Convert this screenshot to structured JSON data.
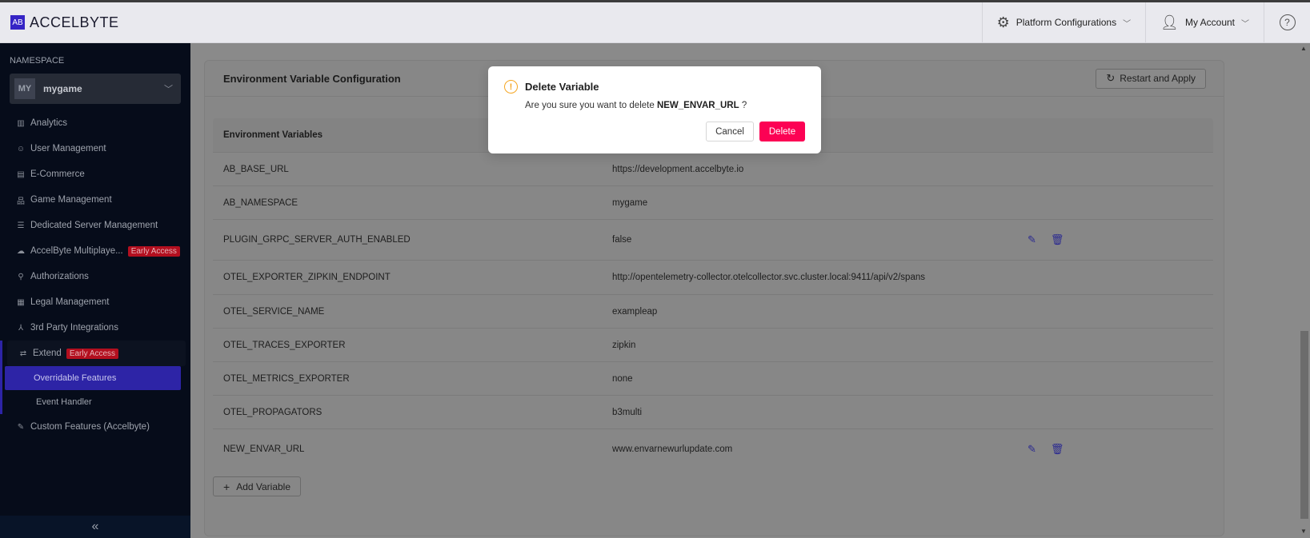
{
  "header": {
    "brand": "ACCELBYTE",
    "brand_mark": "AB",
    "platform_configurations": "Platform Configurations",
    "my_account": "My Account",
    "help_icon": "?"
  },
  "sidebar": {
    "namespace_label": "NAMESPACE",
    "namespace_badge": "MY",
    "namespace_name": "mygame",
    "items": [
      {
        "label": "Analytics",
        "icon": "chart-icon"
      },
      {
        "label": "User Management",
        "icon": "user-icon"
      },
      {
        "label": "E-Commerce",
        "icon": "store-icon"
      },
      {
        "label": "Game Management",
        "icon": "hierarchy-icon"
      },
      {
        "label": "Dedicated Server Management",
        "icon": "server-icon"
      },
      {
        "label": "AccelByte Multiplaye...",
        "icon": "cloud-icon",
        "badge": "Early Access"
      },
      {
        "label": "Authorizations",
        "icon": "key-icon"
      },
      {
        "label": "Legal Management",
        "icon": "document-icon"
      },
      {
        "label": "3rd Party Integrations",
        "icon": "integration-icon"
      },
      {
        "label": "Extend",
        "icon": "extend-icon",
        "badge": "Early Access"
      },
      {
        "label": "Custom Features (Accelbyte)",
        "icon": "wrench-icon"
      }
    ],
    "extend_subitems": [
      {
        "label": "Overridable Features",
        "active": true
      },
      {
        "label": "Event Handler",
        "active": false
      }
    ],
    "collapse_icon": "«"
  },
  "main": {
    "title": "Environment Variable Configuration",
    "restart_button": "Restart and Apply",
    "table_header": "Environment Variables",
    "rows": [
      {
        "name": "AB_BASE_URL",
        "value": "https://development.accelbyte.io",
        "editable": false
      },
      {
        "name": "AB_NAMESPACE",
        "value": "mygame",
        "editable": false
      },
      {
        "name": "PLUGIN_GRPC_SERVER_AUTH_ENABLED",
        "value": "false",
        "editable": true
      },
      {
        "name": "OTEL_EXPORTER_ZIPKIN_ENDPOINT",
        "value": "http://opentelemetry-collector.otelcollector.svc.cluster.local:9411/api/v2/spans",
        "editable": false
      },
      {
        "name": "OTEL_SERVICE_NAME",
        "value": "exampleap",
        "editable": false
      },
      {
        "name": "OTEL_TRACES_EXPORTER",
        "value": "zipkin",
        "editable": false
      },
      {
        "name": "OTEL_METRICS_EXPORTER",
        "value": "none",
        "editable": false
      },
      {
        "name": "OTEL_PROPAGATORS",
        "value": "b3multi",
        "editable": false
      },
      {
        "name": "NEW_ENVAR_URL",
        "value": "www.envarnewurlupdate.com",
        "editable": true
      }
    ],
    "add_button": "Add Variable"
  },
  "modal": {
    "title": "Delete Variable",
    "message_prefix": "Are you sure you want to delete",
    "target": "NEW_ENVAR_URL",
    "message_suffix": "?",
    "cancel": "Cancel",
    "delete": "Delete",
    "delete_color": "#fc0254",
    "warning_color": "#f5a623"
  }
}
